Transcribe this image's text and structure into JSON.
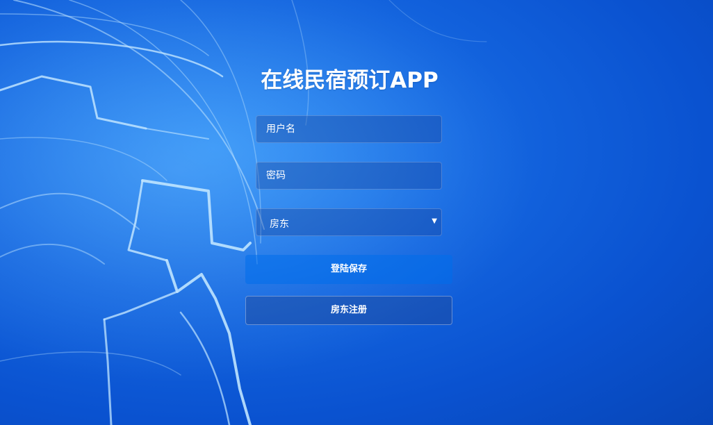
{
  "app": {
    "title": "在线民宿预订APP"
  },
  "form": {
    "username_placeholder": "用户名",
    "username_value": "",
    "password_placeholder": "密码",
    "password_value": "",
    "role_selected": "房东",
    "login_label": "登陆保存",
    "register_label": "房东注册"
  },
  "colors": {
    "background": "#1466e0",
    "text": "#ffffff"
  }
}
